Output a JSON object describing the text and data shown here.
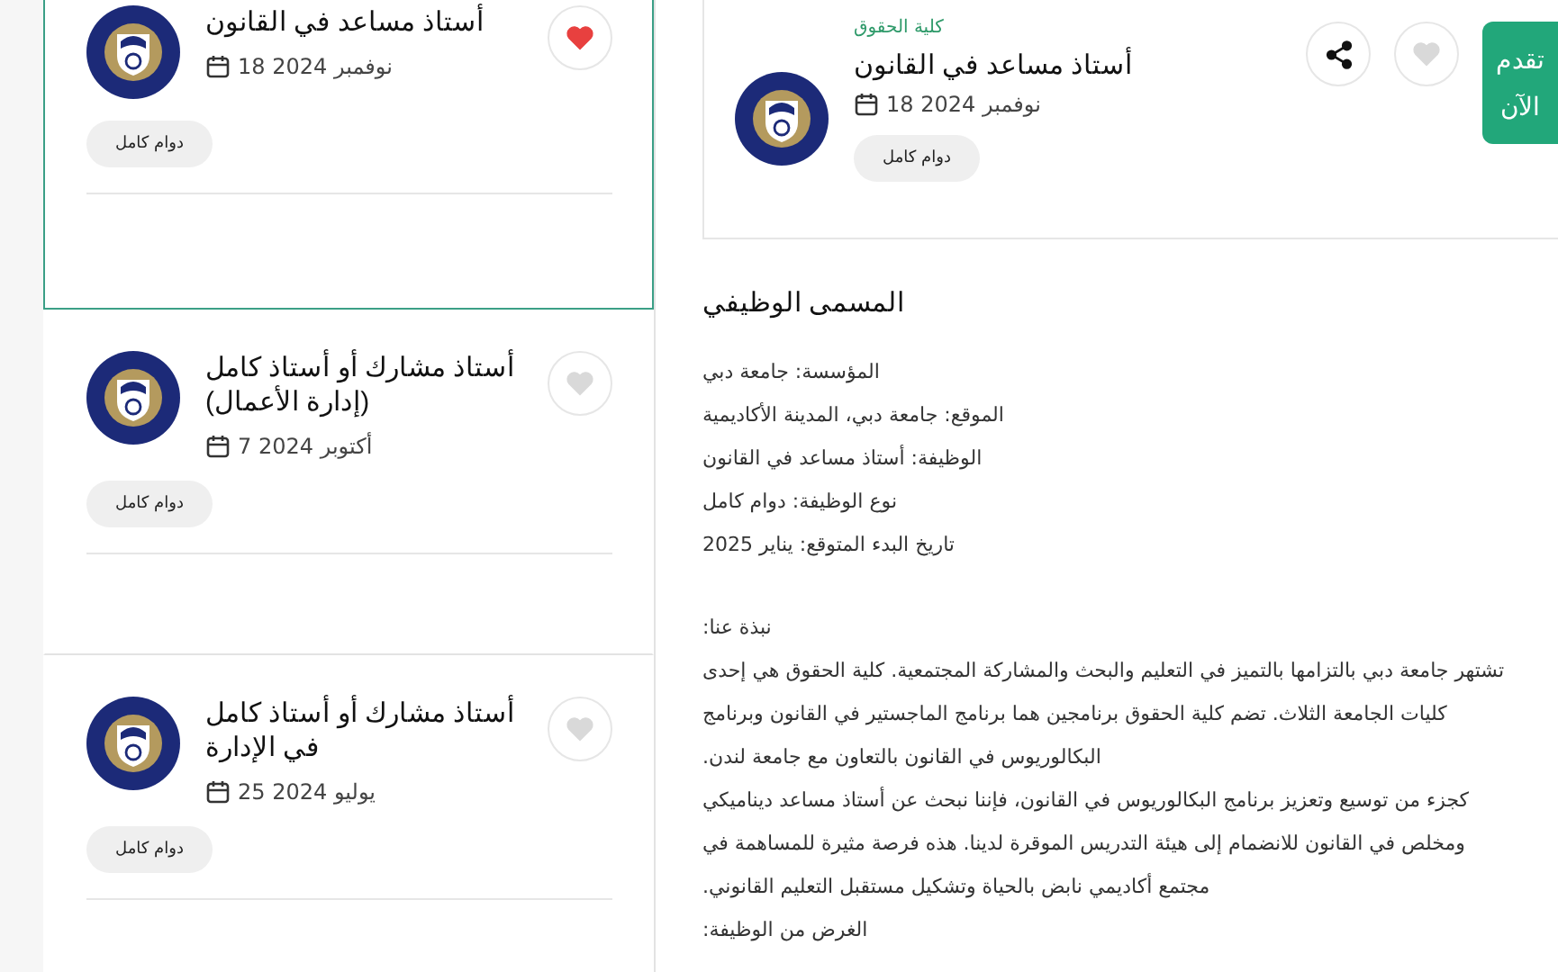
{
  "jobs": [
    {
      "title": "أستاذ مساعد في القانون",
      "date": "نوفمبر 2024 18",
      "type": "دوام كامل",
      "liked": true,
      "selected": true
    },
    {
      "title": "أستاذ مشارك أو أستاذ كامل (إدارة الأعمال)",
      "date": "أكتوبر 2024 7",
      "type": "دوام كامل",
      "liked": false,
      "selected": false
    },
    {
      "title": "أستاذ مشارك أو أستاذ كامل في الإدارة",
      "date": "يوليو 2024 25",
      "type": "دوام كامل",
      "liked": false,
      "selected": false
    }
  ],
  "detail": {
    "category": "كلية الحقوق",
    "title": "أستاذ مساعد في القانون",
    "date": "نوفمبر 2024 18",
    "type": "دوام كامل",
    "liked": false,
    "apply_label": "تقدم الآن",
    "section_title": "المسمى الوظيفي",
    "facts": [
      "المؤسسة: جامعة دبي",
      "الموقع: جامعة دبي، المدينة الأكاديمية",
      "الوظيفة: أستاذ مساعد في القانون",
      "نوع الوظيفة: دوام كامل",
      "تاريخ البدء المتوقع: يناير 2025"
    ],
    "paragraphs": [
      "نبذة عنا:",
      "تشتهر جامعة دبي بالتزامها بالتميز في التعليم والبحث والمشاركة المجتمعية. كلية الحقوق هي إحدى كليات الجامعة الثلاث. تضم كلية الحقوق برنامجين هما برنامج الماجستير في القانون وبرنامج البكالوريوس في القانون بالتعاون مع جامعة لندن.",
      "كجزء من توسيع وتعزيز برنامج البكالوريوس في القانون، فإننا نبحث عن أستاذ مساعد ديناميكي ومخلص في القانون للانضمام إلى هيئة التدريس الموقرة لدينا. هذه فرصة مثيرة للمساهمة في مجتمع أكاديمي نابض بالحياة وتشكيل مستقبل التعليم القانوني.",
      "الغرض من الوظيفة:"
    ]
  }
}
